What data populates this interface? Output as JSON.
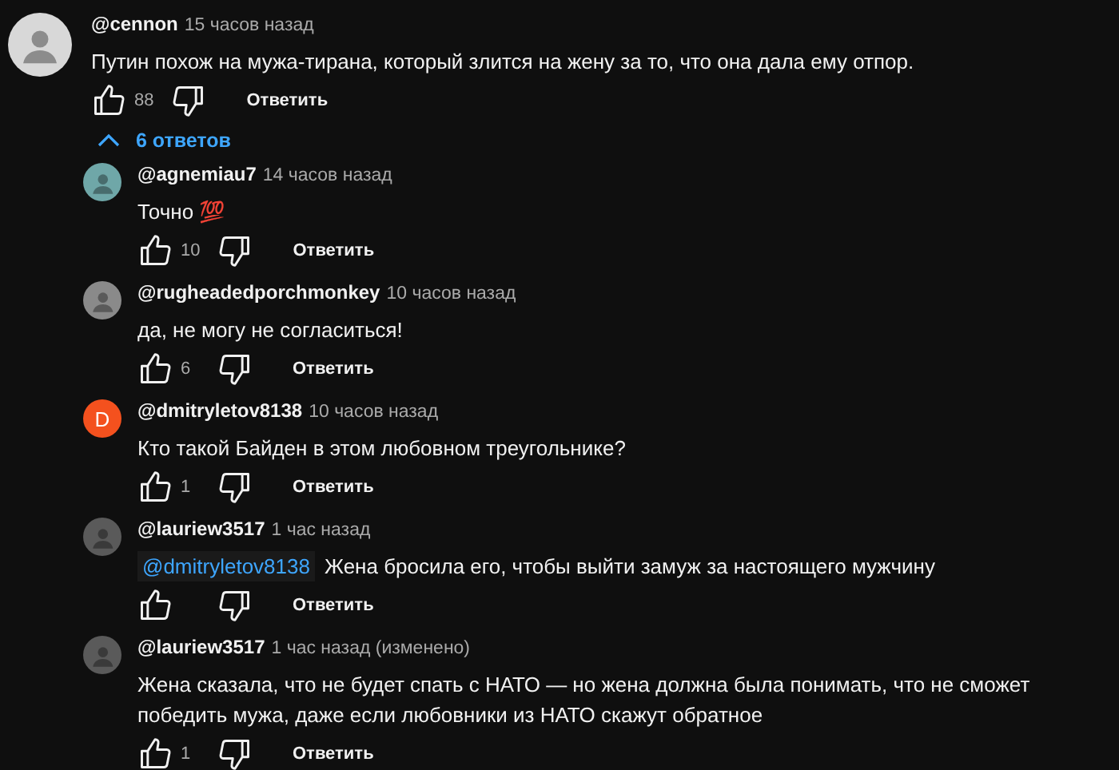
{
  "comment": {
    "author": "@cennon",
    "time": "15 часов назад",
    "avatar": {
      "kind": "photo",
      "color": "#d8d8d8"
    },
    "text": "Путин похож на мужа-тирана, который злится на жену за то, что она дала ему отпор.",
    "likes": "88",
    "reply_label": "Ответить"
  },
  "replies_toggle": {
    "label": "6 ответов",
    "expanded": true
  },
  "replies": [
    {
      "author": "@agnemiau7",
      "time": "14 часов назад",
      "avatar": {
        "kind": "photo",
        "color": "#6fa7a8"
      },
      "text": "Точно 💯",
      "likes": "10",
      "reply_label": "Ответить"
    },
    {
      "author": "@rugheadedporchmonkey",
      "time": "10 часов назад",
      "avatar": {
        "kind": "photo",
        "color": "#8a8a8a"
      },
      "text": "да, не могу не согласиться!",
      "likes": "6",
      "reply_label": "Ответить"
    },
    {
      "author": "@dmitryletov8138",
      "time": "10 часов назад",
      "avatar": {
        "kind": "letter",
        "letter": "D",
        "color": "#f4511e"
      },
      "text": "Кто такой Байден в этом любовном треугольнике?",
      "likes": "1",
      "reply_label": "Ответить"
    },
    {
      "author": "@lauriew3517",
      "time": "1 час назад",
      "avatar": {
        "kind": "photo",
        "color": "#5a5a5a"
      },
      "mention": "@dmitryletov8138",
      "text": "Жена бросила его, чтобы выйти замуж за настоящего мужчину",
      "reply_label": "Ответить"
    },
    {
      "author": "@lauriew3517",
      "time": "1 час назад (изменено)",
      "avatar": {
        "kind": "photo",
        "color": "#5a5a5a"
      },
      "text": "Жена сказала, что не будет спать с НАТО — но жена должна была понимать, что не сможет победить мужа, даже если любовники из НАТО скажут обратное",
      "likes": "1",
      "reply_label": "Ответить"
    }
  ]
}
